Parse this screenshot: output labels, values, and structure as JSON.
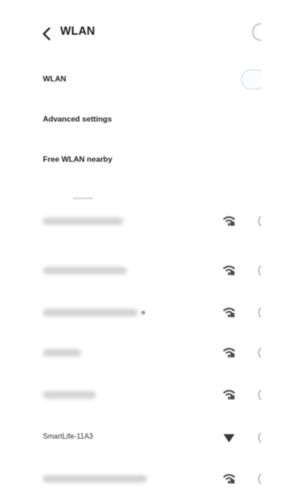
{
  "header": {
    "back_icon": "chevron-left-icon",
    "title": "WLAN"
  },
  "settings": {
    "wlan_label": "WLAN",
    "advanced_label": "Advanced settings",
    "free_wlan_label": "Free WLAN nearby"
  },
  "networks": [
    {
      "name": "",
      "secured": true
    },
    {
      "name": "",
      "secured": true
    },
    {
      "name": "",
      "secured": true
    },
    {
      "name": "",
      "secured": true
    },
    {
      "name": "",
      "secured": true
    },
    {
      "name": "SmartLife-11A3",
      "secured": false
    },
    {
      "name": "",
      "secured": true
    }
  ],
  "colors": {
    "text_primary": "#1e1e1e",
    "icon_gray": "#4a4a4a",
    "toggle_border": "#d8dde3"
  }
}
